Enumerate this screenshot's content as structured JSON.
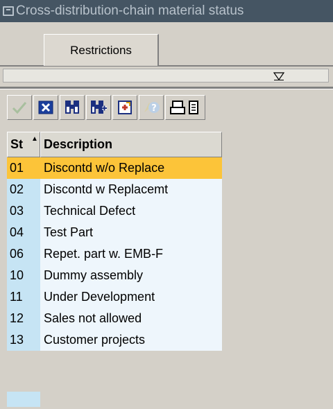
{
  "window": {
    "title": "Cross-distribution-chain material status",
    "icon": "window-icon"
  },
  "tabs": [
    {
      "label": "Restrictions",
      "active": true
    }
  ],
  "toolbar": {
    "buttons": [
      {
        "name": "check-button",
        "icon": "checkmark-icon",
        "enabled": false
      },
      {
        "name": "cancel-button",
        "icon": "cancel-x-icon",
        "enabled": true
      },
      {
        "name": "find-button",
        "icon": "binoculars-icon",
        "enabled": true
      },
      {
        "name": "find-next-button",
        "icon": "binoculars-plus-icon",
        "enabled": true
      },
      {
        "name": "new-entries-button",
        "icon": "new-entries-icon",
        "enabled": true
      },
      {
        "name": "help-button",
        "icon": "help-icon",
        "enabled": false
      },
      {
        "name": "print-button",
        "icon": "printer-icon",
        "enabled": true
      }
    ]
  },
  "table": {
    "columns": [
      {
        "label": "St"
      },
      {
        "label": "Description"
      }
    ],
    "sorted_column": "St",
    "rows": [
      {
        "code": "01",
        "description": "Discontd w/o Replace",
        "selected": true
      },
      {
        "code": "02",
        "description": "Discontd w Replacemt"
      },
      {
        "code": "03",
        "description": "Technical Defect"
      },
      {
        "code": "04",
        "description": "Test Part"
      },
      {
        "code": "06",
        "description": "Repet. part w. EMB-F"
      },
      {
        "code": "10",
        "description": "Dummy assembly"
      },
      {
        "code": "11",
        "description": "Under Development"
      },
      {
        "code": "12",
        "description": "Sales not allowed"
      },
      {
        "code": "13",
        "description": "Customer projects"
      }
    ]
  },
  "colors": {
    "title_bg": "#455563",
    "selected_row": "#fcc439",
    "key_column": "#c6e4f4",
    "row_bg": "#eef6fc"
  }
}
